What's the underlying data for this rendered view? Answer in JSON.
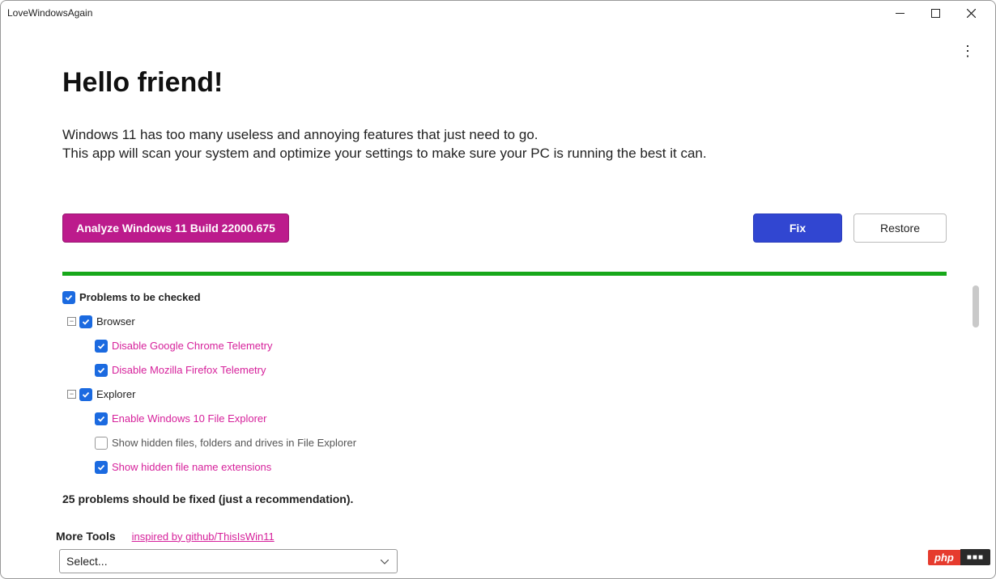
{
  "window": {
    "title": "LoveWindowsAgain"
  },
  "header": {
    "title": "Hello friend!",
    "line1": "Windows 11 has too many useless and annoying features that just need to go.",
    "line2": "This app will scan your system and optimize your settings to make sure your PC is running the best it can."
  },
  "buttons": {
    "analyze": "Analyze Windows 11 Build 22000.675",
    "fix": "Fix",
    "restore": "Restore"
  },
  "tree": {
    "root_label": "Problems to be checked",
    "groups": [
      {
        "label": "Browser",
        "items": [
          {
            "label": "Disable Google Chrome Telemetry",
            "checked": true
          },
          {
            "label": "Disable Mozilla Firefox Telemetry",
            "checked": true
          }
        ]
      },
      {
        "label": "Explorer",
        "items": [
          {
            "label": "Enable Windows 10 File Explorer",
            "checked": true
          },
          {
            "label": "Show hidden files, folders and drives in File Explorer",
            "checked": false
          },
          {
            "label": "Show hidden file name extensions",
            "checked": true
          }
        ]
      }
    ]
  },
  "status": "25 problems should be fixed (just a recommendation).",
  "more_tools": {
    "label": "More Tools",
    "link": "inspired by github/ThisIsWin11",
    "select_placeholder": "Select..."
  },
  "badge": {
    "left": "php",
    "right": "■■■"
  }
}
